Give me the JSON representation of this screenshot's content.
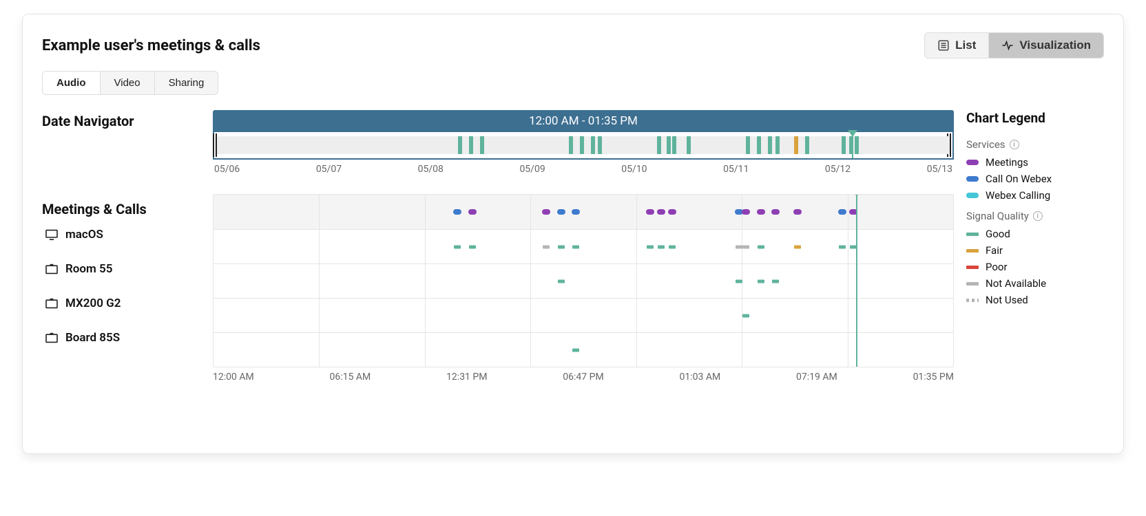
{
  "header": {
    "title": "Example user's meetings & calls",
    "list_label": "List",
    "viz_label": "Visualization"
  },
  "tabs": {
    "audio": "Audio",
    "video": "Video",
    "sharing": "Sharing",
    "active": "audio"
  },
  "sections": {
    "date_nav": "Date Navigator",
    "meetings_calls": "Meetings & Calls"
  },
  "date_navigator": {
    "range_label": "12:00 AM - 01:35 PM",
    "dates": [
      "05/06",
      "05/07",
      "05/08",
      "05/09",
      "05/10",
      "05/11",
      "05/12",
      "05/13"
    ],
    "caret_pct": 86.5,
    "events": [
      {
        "pct": 33,
        "color": "good"
      },
      {
        "pct": 34.5,
        "color": "good"
      },
      {
        "pct": 36,
        "color": "good"
      },
      {
        "pct": 48,
        "color": "good"
      },
      {
        "pct": 49.5,
        "color": "good"
      },
      {
        "pct": 51,
        "color": "good"
      },
      {
        "pct": 52,
        "color": "good"
      },
      {
        "pct": 60,
        "color": "good"
      },
      {
        "pct": 61.3,
        "color": "good"
      },
      {
        "pct": 62,
        "color": "good"
      },
      {
        "pct": 64,
        "color": "good"
      },
      {
        "pct": 72,
        "color": "good"
      },
      {
        "pct": 73.5,
        "color": "good"
      },
      {
        "pct": 75,
        "color": "good"
      },
      {
        "pct": 76,
        "color": "good"
      },
      {
        "pct": 78.5,
        "color": "fair"
      },
      {
        "pct": 80,
        "color": "good"
      },
      {
        "pct": 85,
        "color": "good"
      },
      {
        "pct": 86,
        "color": "good"
      },
      {
        "pct": 86.8,
        "color": "good"
      }
    ]
  },
  "timeline": {
    "times": [
      "12:00 AM",
      "06:15 AM",
      "12:31 PM",
      "06:47 PM",
      "01:03 AM",
      "07:19 AM",
      "01:35 PM"
    ],
    "caret_pct": 87,
    "rows": [
      {
        "id": "meetings_calls",
        "label": "",
        "icon": "",
        "header": true,
        "markers": [
          {
            "pct": 33,
            "type": "pill",
            "color": "blue"
          },
          {
            "pct": 35,
            "type": "pill",
            "color": "purple"
          },
          {
            "pct": 45,
            "type": "pill",
            "color": "purple"
          },
          {
            "pct": 47,
            "type": "pill",
            "color": "blue"
          },
          {
            "pct": 49,
            "type": "pill",
            "color": "blue"
          },
          {
            "pct": 59,
            "type": "pill",
            "color": "purple"
          },
          {
            "pct": 60.5,
            "type": "pill",
            "color": "purple"
          },
          {
            "pct": 62,
            "type": "pill",
            "color": "purple"
          },
          {
            "pct": 71,
            "type": "pill",
            "color": "blue"
          },
          {
            "pct": 72,
            "type": "pill",
            "color": "purple"
          },
          {
            "pct": 74,
            "type": "pill",
            "color": "purple"
          },
          {
            "pct": 76,
            "type": "pill",
            "color": "purple"
          },
          {
            "pct": 79,
            "type": "pill",
            "color": "purple"
          },
          {
            "pct": 85,
            "type": "pill",
            "color": "blue"
          },
          {
            "pct": 86.5,
            "type": "pill",
            "color": "purple"
          }
        ]
      },
      {
        "id": "macos",
        "label": "macOS",
        "icon": "desktop",
        "markers": [
          {
            "pct": 33,
            "type": "bar",
            "color": "good"
          },
          {
            "pct": 35,
            "type": "bar",
            "color": "good"
          },
          {
            "pct": 45,
            "type": "bar",
            "color": "na"
          },
          {
            "pct": 47,
            "type": "bar",
            "color": "good"
          },
          {
            "pct": 49,
            "type": "bar",
            "color": "good"
          },
          {
            "pct": 59,
            "type": "bar",
            "color": "good"
          },
          {
            "pct": 60.5,
            "type": "bar",
            "color": "good"
          },
          {
            "pct": 62,
            "type": "bar",
            "color": "good"
          },
          {
            "pct": 71,
            "type": "bar",
            "color": "na"
          },
          {
            "pct": 72,
            "type": "bar",
            "color": "na"
          },
          {
            "pct": 74,
            "type": "bar",
            "color": "good"
          },
          {
            "pct": 79,
            "type": "bar",
            "color": "fair"
          },
          {
            "pct": 85,
            "type": "bar",
            "color": "good"
          },
          {
            "pct": 86.5,
            "type": "bar",
            "color": "good"
          }
        ]
      },
      {
        "id": "room55",
        "label": "Room 55",
        "icon": "device",
        "markers": [
          {
            "pct": 47,
            "type": "bar",
            "color": "good"
          },
          {
            "pct": 71,
            "type": "bar",
            "color": "good"
          },
          {
            "pct": 74,
            "type": "bar",
            "color": "good"
          },
          {
            "pct": 76,
            "type": "bar",
            "color": "good"
          }
        ]
      },
      {
        "id": "mx200",
        "label": "MX200 G2",
        "icon": "device",
        "markers": [
          {
            "pct": 72,
            "type": "bar",
            "color": "good"
          }
        ]
      },
      {
        "id": "board85s",
        "label": "Board 85S",
        "icon": "device",
        "markers": [
          {
            "pct": 49,
            "type": "bar",
            "color": "good"
          }
        ]
      }
    ]
  },
  "legend": {
    "title": "Chart Legend",
    "services_label": "Services",
    "services": [
      {
        "label": "Meetings",
        "color": "purple"
      },
      {
        "label": "Call On Webex",
        "color": "blue"
      },
      {
        "label": "Webex Calling",
        "color": "teal"
      }
    ],
    "signal_label": "Signal Quality",
    "signal": [
      {
        "label": "Good",
        "color": "good",
        "style": "bar"
      },
      {
        "label": "Fair",
        "color": "fair",
        "style": "bar"
      },
      {
        "label": "Poor",
        "color": "poor",
        "style": "bar"
      },
      {
        "label": "Not Available",
        "color": "na",
        "style": "bar"
      },
      {
        "label": "Not Used",
        "color": "na",
        "style": "dots"
      }
    ]
  },
  "colors": {
    "purple": "#8e3fb3",
    "blue": "#3e7bce",
    "teal": "#45c6d6",
    "good": "#5fb39c",
    "fair": "#d9a23c",
    "poor": "#d9453c",
    "na": "#b5b5b5"
  },
  "chart_data": {
    "type": "timeline",
    "title": "Example user's meetings & calls",
    "date_range": [
      "05/06",
      "05/13"
    ],
    "displayed_window": "12:00 AM - 01:35 PM",
    "time_axis": [
      "12:00 AM",
      "06:15 AM",
      "12:31 PM",
      "06:47 PM",
      "01:03 AM",
      "07:19 AM",
      "01:35 PM"
    ],
    "series": [
      {
        "name": "Meetings & Calls",
        "kind": "service-events",
        "points": [
          {
            "t": 33,
            "service": "Call On Webex"
          },
          {
            "t": 35,
            "service": "Meetings"
          },
          {
            "t": 45,
            "service": "Meetings"
          },
          {
            "t": 47,
            "service": "Call On Webex"
          },
          {
            "t": 49,
            "service": "Call On Webex"
          },
          {
            "t": 59,
            "service": "Meetings"
          },
          {
            "t": 60.5,
            "service": "Meetings"
          },
          {
            "t": 62,
            "service": "Meetings"
          },
          {
            "t": 71,
            "service": "Call On Webex"
          },
          {
            "t": 72,
            "service": "Meetings"
          },
          {
            "t": 74,
            "service": "Meetings"
          },
          {
            "t": 76,
            "service": "Meetings"
          },
          {
            "t": 79,
            "service": "Meetings"
          },
          {
            "t": 85,
            "service": "Call On Webex"
          },
          {
            "t": 86.5,
            "service": "Meetings"
          }
        ]
      },
      {
        "name": "macOS",
        "kind": "device-quality",
        "points": [
          {
            "t": 33,
            "q": "Good"
          },
          {
            "t": 35,
            "q": "Good"
          },
          {
            "t": 45,
            "q": "Not Available"
          },
          {
            "t": 47,
            "q": "Good"
          },
          {
            "t": 49,
            "q": "Good"
          },
          {
            "t": 59,
            "q": "Good"
          },
          {
            "t": 60.5,
            "q": "Good"
          },
          {
            "t": 62,
            "q": "Good"
          },
          {
            "t": 71,
            "q": "Not Available"
          },
          {
            "t": 72,
            "q": "Not Available"
          },
          {
            "t": 74,
            "q": "Good"
          },
          {
            "t": 79,
            "q": "Fair"
          },
          {
            "t": 85,
            "q": "Good"
          },
          {
            "t": 86.5,
            "q": "Good"
          }
        ]
      },
      {
        "name": "Room 55",
        "kind": "device-quality",
        "points": [
          {
            "t": 47,
            "q": "Good"
          },
          {
            "t": 71,
            "q": "Good"
          },
          {
            "t": 74,
            "q": "Good"
          },
          {
            "t": 76,
            "q": "Good"
          }
        ]
      },
      {
        "name": "MX200 G2",
        "kind": "device-quality",
        "points": [
          {
            "t": 72,
            "q": "Good"
          }
        ]
      },
      {
        "name": "Board 85S",
        "kind": "device-quality",
        "points": [
          {
            "t": 49,
            "q": "Good"
          }
        ]
      }
    ],
    "legend": {
      "services": [
        "Meetings",
        "Call On Webex",
        "Webex Calling"
      ],
      "signal_quality": [
        "Good",
        "Fair",
        "Poor",
        "Not Available",
        "Not Used"
      ]
    }
  }
}
